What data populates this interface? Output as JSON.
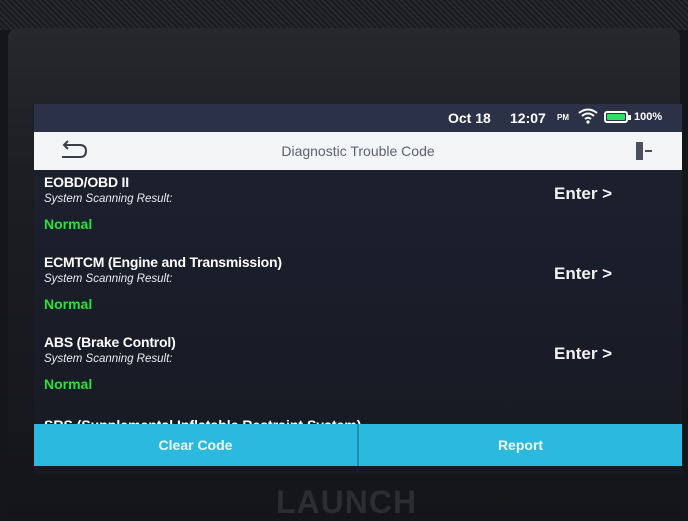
{
  "status": {
    "date": "Oct 18",
    "time": "12:07",
    "signal": "PM",
    "battery_text": "100%",
    "battery_level": 1.0,
    "battery_color": "#2ee06a"
  },
  "header": {
    "title": "Diagnostic Trouble Code"
  },
  "items": [
    {
      "name": "EOBD/OBD II",
      "sub": "System Scanning Result:",
      "result": "Normal",
      "action": "Enter >"
    },
    {
      "name": "ECMTCM (Engine and Transmission)",
      "sub": "System Scanning Result:",
      "result": "Normal",
      "action": "Enter >"
    },
    {
      "name": "ABS (Brake Control)",
      "sub": "System Scanning Result:",
      "result": "Normal",
      "action": "Enter >"
    },
    {
      "name": "SRS (Supplemental Inflatable Restraint System)"
    }
  ],
  "footer": {
    "clear_label": "Clear Code",
    "report_label": "Report"
  },
  "device": {
    "brand": "LAUNCH"
  },
  "colors": {
    "accent": "#2bb9dd",
    "status_ok": "#27e23a"
  }
}
